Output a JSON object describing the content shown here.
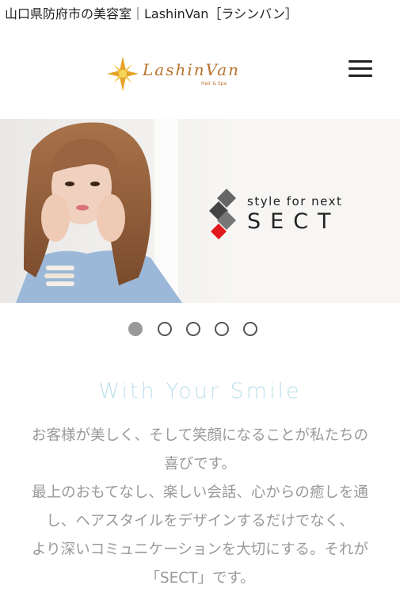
{
  "page": {
    "title": "山口県防府市の美容室｜LashinVan［ラシンバン］"
  },
  "header": {
    "logo_text": "LashinVan",
    "logo_subtext": "Hair & Spa",
    "menu_icon": "hamburger-icon"
  },
  "hero": {
    "brand_tagline": "style for next",
    "brand_name": "SECT"
  },
  "carousel": {
    "slides": 5,
    "active_index": 0
  },
  "intro": {
    "heading": "With Your Smile",
    "lines": [
      "お客様が美しく、そして笑顔になることが私たちの",
      "喜びです。",
      "最上のおもてなし、楽しい会話、心からの癒しを通",
      "し、ヘアスタイルをデザインするだけでなく、",
      "より深いコミュニケーションを大切にする。それが",
      "「SECT」です。"
    ]
  },
  "colors": {
    "logo": "#b8722b",
    "heading": "#bfe1ec",
    "body_text": "#9a9a9a",
    "accent_red": "#e0191f"
  }
}
